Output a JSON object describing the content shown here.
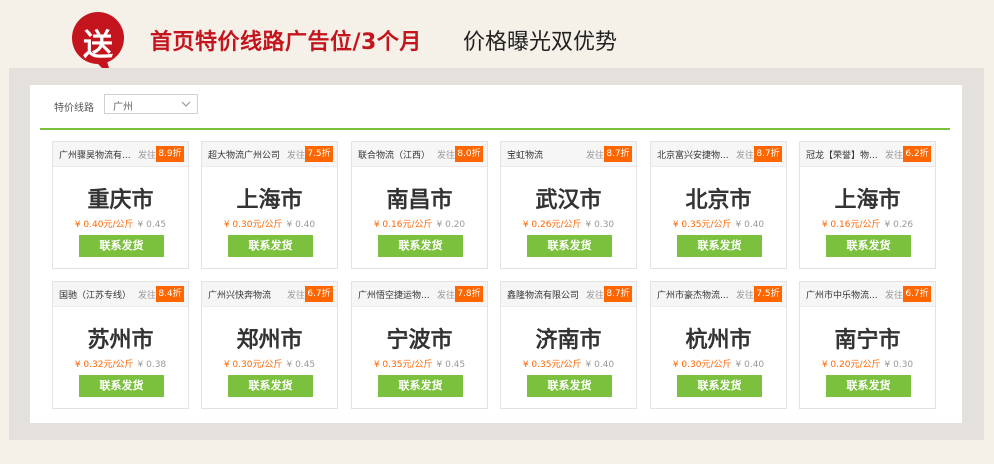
{
  "banner": {
    "badge_text": "送",
    "headline_red": "首页特价线路广告位/3个月",
    "headline_black": "价格曝光双优势",
    "badge_color": "#c4141d"
  },
  "filter": {
    "label": "特价线路",
    "selected": "广州"
  },
  "accent_colors": {
    "green": "#7cc13e",
    "orange": "#ff6600",
    "red": "#c4141d"
  },
  "cards": [
    {
      "company": "广州骤昊物流有...",
      "origin": "发往",
      "discount": "8.9折",
      "city": "重庆市",
      "price_now": "¥ 0.40元/公斤",
      "price_old": "¥ 0.45",
      "button": "联系发货"
    },
    {
      "company": "超大物流广州公司",
      "origin": "发往",
      "discount": "7.5折",
      "city": "上海市",
      "price_now": "¥ 0.30元/公斤",
      "price_old": "¥ 0.40",
      "button": "联系发货"
    },
    {
      "company": "联合物流（江西）",
      "origin": "发往",
      "discount": "8.0折",
      "city": "南昌市",
      "price_now": "¥ 0.16元/公斤",
      "price_old": "¥ 0.20",
      "button": "联系发货"
    },
    {
      "company": "宝虹物流",
      "origin": "发往",
      "discount": "8.7折",
      "city": "武汉市",
      "price_now": "¥ 0.26元/公斤",
      "price_old": "¥ 0.30",
      "button": "联系发货"
    },
    {
      "company": "北京富兴安捷物...",
      "origin": "发往",
      "discount": "8.7折",
      "city": "北京市",
      "price_now": "¥ 0.35元/公斤",
      "price_old": "¥ 0.40",
      "button": "联系发货"
    },
    {
      "company": "冠龙【荣誉】物...",
      "origin": "发往",
      "discount": "6.2折",
      "city": "上海市",
      "price_now": "¥ 0.16元/公斤",
      "price_old": "¥ 0.26",
      "button": "联系发货"
    },
    {
      "company": "国驰（江苏专线）",
      "origin": "发往",
      "discount": "8.4折",
      "city": "苏州市",
      "price_now": "¥ 0.32元/公斤",
      "price_old": "¥ 0.38",
      "button": "联系发货"
    },
    {
      "company": "广州兴快奔物流",
      "origin": "发往",
      "discount": "6.7折",
      "city": "郑州市",
      "price_now": "¥ 0.30元/公斤",
      "price_old": "¥ 0.45",
      "button": "联系发货"
    },
    {
      "company": "广州悟空捷运物...",
      "origin": "发往",
      "discount": "7.8折",
      "city": "宁波市",
      "price_now": "¥ 0.35元/公斤",
      "price_old": "¥ 0.45",
      "button": "联系发货"
    },
    {
      "company": "鑫隆物流有限公司",
      "origin": "发往",
      "discount": "8.7折",
      "city": "济南市",
      "price_now": "¥ 0.35元/公斤",
      "price_old": "¥ 0.40",
      "button": "联系发货"
    },
    {
      "company": "广州市豪杰物流...",
      "origin": "发往",
      "discount": "7.5折",
      "city": "杭州市",
      "price_now": "¥ 0.30元/公斤",
      "price_old": "¥ 0.40",
      "button": "联系发货"
    },
    {
      "company": "广州市中乐物流...",
      "origin": "发往",
      "discount": "6.7折",
      "city": "南宁市",
      "price_now": "¥ 0.20元/公斤",
      "price_old": "¥ 0.30",
      "button": "联系发货"
    }
  ]
}
